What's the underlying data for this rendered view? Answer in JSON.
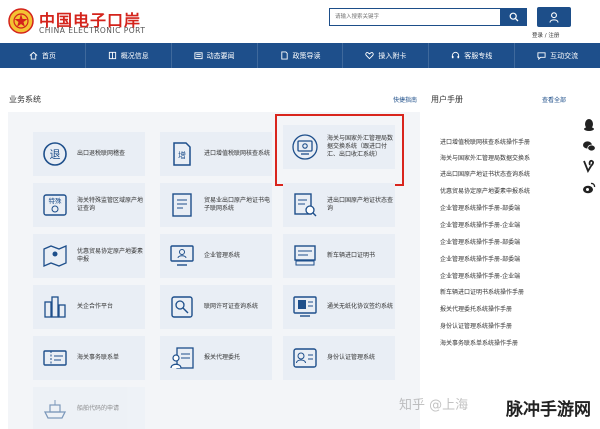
{
  "header": {
    "logo_cn": "中国电子口岸",
    "logo_en": "CHINA ELECTRONIC PORT",
    "search_placeholder": "请输入搜索关键字",
    "login_label": "登录 / 注册"
  },
  "nav": [
    {
      "label": "首页",
      "icon": "home-icon"
    },
    {
      "label": "概况信息",
      "icon": "book-icon"
    },
    {
      "label": "动态要闻",
      "icon": "news-icon"
    },
    {
      "label": "政策导读",
      "icon": "document-icon"
    },
    {
      "label": "操入附卡",
      "icon": "heart-icon"
    },
    {
      "label": "客服专线",
      "icon": "headset-icon"
    },
    {
      "label": "互动交流",
      "icon": "chat-icon"
    }
  ],
  "business": {
    "title": "业务系统",
    "link": "快捷指南"
  },
  "tiles": [
    {
      "label": "出口退税联网稽查",
      "icon": "tui-icon"
    },
    {
      "label": "进口增值税联网核查系统",
      "icon": "vat-icon"
    },
    {
      "label": "海关与国家外汇管理局数据交换系统（跟进口付汇、出口收汇系统）",
      "icon": "exchange-icon"
    },
    {
      "label": "海关特殊监管区域原产地证查询",
      "icon": "special-icon"
    },
    {
      "label": "贸易业出口原产地证书电子联网系统",
      "icon": "certificate-icon"
    },
    {
      "label": "进出口国原产地证状态查询",
      "icon": "status-query-icon"
    },
    {
      "label": "优惠贸易协定原产地要素申报",
      "icon": "map-icon"
    },
    {
      "label": "企业管理系统",
      "icon": "enterprise-icon"
    },
    {
      "label": "新车辆进口证明书",
      "icon": "car-icon"
    },
    {
      "label": "关企合作平台",
      "icon": "cooperation-icon"
    },
    {
      "label": "联网许可证查询系统",
      "icon": "license-icon"
    },
    {
      "label": "通关无纸化协议签约系统",
      "icon": "paperless-icon"
    },
    {
      "label": "海关事务联系单",
      "icon": "ticket-icon"
    },
    {
      "label": "报关代理委托",
      "icon": "agent-icon"
    },
    {
      "label": "身份认证管理系统",
      "icon": "identity-icon"
    },
    {
      "label": "船舶代码的申请",
      "icon": "ship-icon"
    }
  ],
  "manual": {
    "title": "用户手册",
    "link": "查看全部",
    "items": [
      "进口增值税联网核查系统操作手册",
      "海关与国家外汇管理局数据交换系",
      "进出口国原产地证书状态查询系统",
      "优惠贸易协定原产地要素申报系统",
      "企业管理系统操作手册-部委端",
      "企业管理系统操作手册-企业端",
      "企业管理系统操作手册-部委端",
      "企业管理系统操作手册-部委端",
      "企业管理系统操作手册-企业端",
      "新车辆进口证明书系统操作手册",
      "报关代理委托系统操作手册",
      "身份认证管理系统操作手册",
      "海关事务联系单系统操作手册"
    ]
  },
  "side_icons": [
    "qq-icon",
    "wechat-icon",
    "vine-icon",
    "weibo-icon"
  ],
  "watermark": {
    "text": "知乎 @上海",
    "brand": "脉冲手游网"
  },
  "colors": {
    "primary": "#1e4f8b",
    "brand_red": "#d4231b",
    "highlight_border": "#d9251d",
    "tile_bg": "#e9eef5"
  }
}
